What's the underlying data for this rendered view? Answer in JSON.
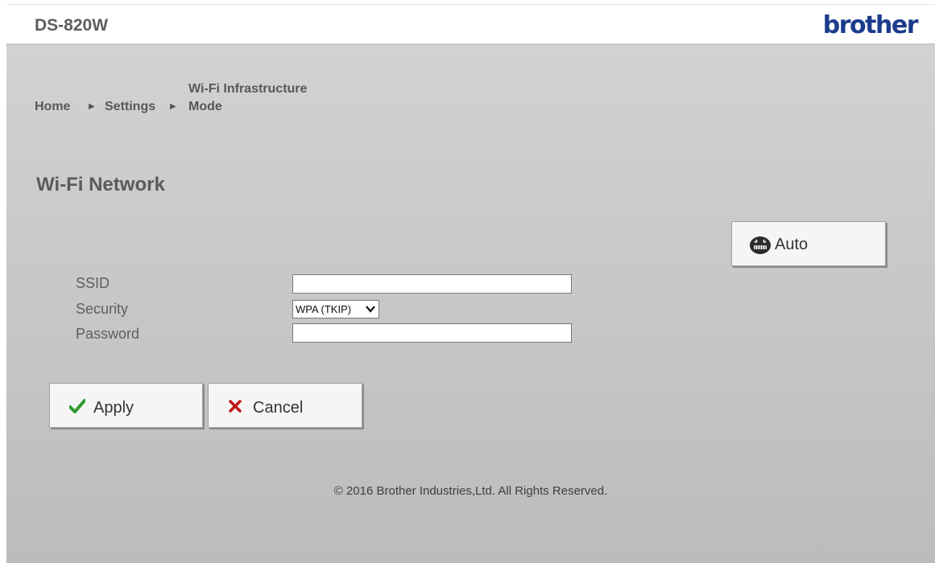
{
  "header": {
    "model": "DS-820W",
    "brand": "brother"
  },
  "breadcrumb": {
    "items": [
      "Home",
      "Settings"
    ],
    "current": "Wi-Fi Infrastructure Mode"
  },
  "page_title": "Wi-Fi Network",
  "auto_button": {
    "label": "Auto"
  },
  "form": {
    "ssid": {
      "label": "SSID",
      "value": ""
    },
    "security": {
      "label": "Security",
      "selected": "WPA (TKIP)"
    },
    "password": {
      "label": "Password",
      "value": ""
    }
  },
  "buttons": {
    "apply": "Apply",
    "cancel": "Cancel"
  },
  "footer": "© 2016 Brother Industries,Ltd. All Rights Reserved.",
  "colors": {
    "brand": "#1b3b8c",
    "apply_check": "#2e9a2e",
    "cancel_x": "#c0161c"
  },
  "icons": {
    "auto": "wireless-setup-icon",
    "apply": "checkmark-icon",
    "cancel": "x-icon",
    "crumb_separator": "triangle-right-icon"
  }
}
